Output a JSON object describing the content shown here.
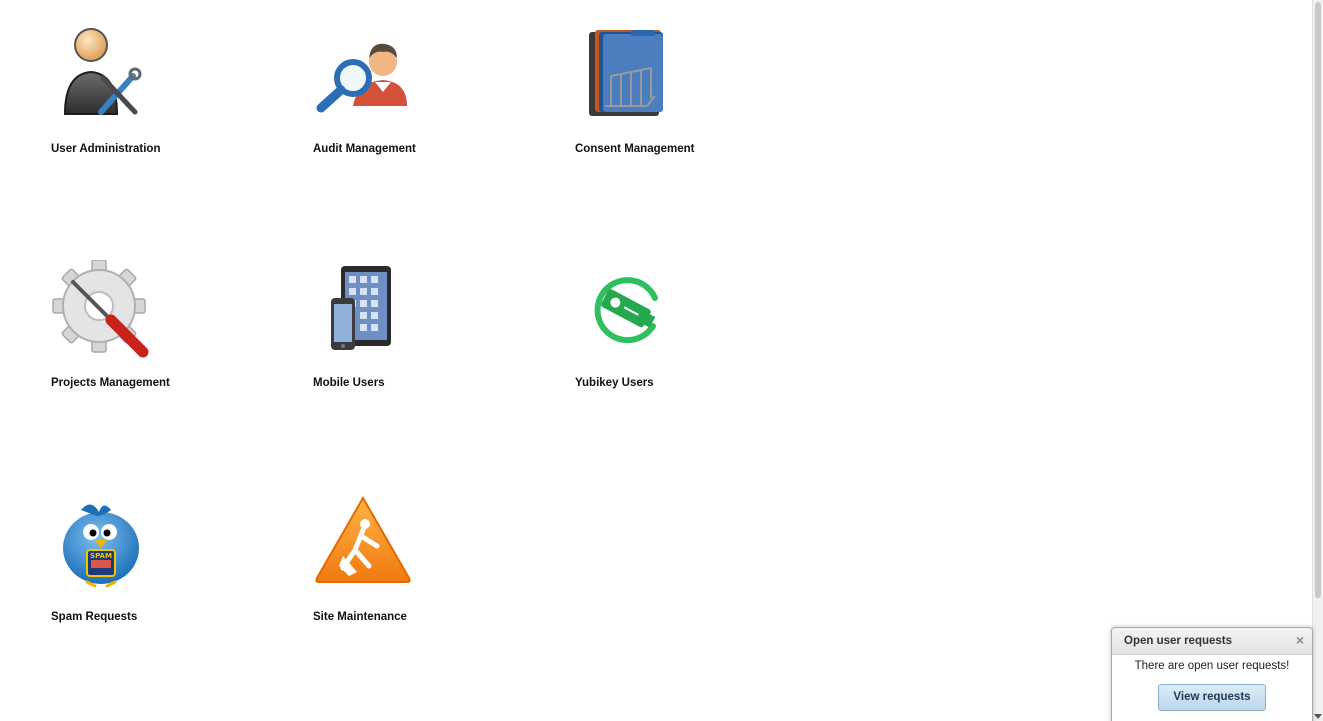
{
  "tiles": [
    {
      "id": "user-administration",
      "label": "User Administration",
      "icon": "user-admin-icon"
    },
    {
      "id": "audit-management",
      "label": "Audit Management",
      "icon": "audit-search-icon"
    },
    {
      "id": "consent-management",
      "label": "Consent Management",
      "icon": "folder-rack-icon"
    },
    {
      "id": "projects-management",
      "label": "Projects Management",
      "icon": "gear-screwdriver-icon"
    },
    {
      "id": "mobile-users",
      "label": "Mobile Users",
      "icon": "mobile-devices-icon"
    },
    {
      "id": "yubikey-users",
      "label": "Yubikey Users",
      "icon": "yubikey-icon"
    },
    {
      "id": "spam-requests",
      "label": "Spam Requests",
      "icon": "spam-bird-icon"
    },
    {
      "id": "site-maintenance",
      "label": "Site Maintenance",
      "icon": "maintenance-warning-icon"
    }
  ],
  "notification": {
    "title": "Open user requests",
    "close_label": "×",
    "message": "There are open user requests!",
    "button_label": "View requests"
  }
}
